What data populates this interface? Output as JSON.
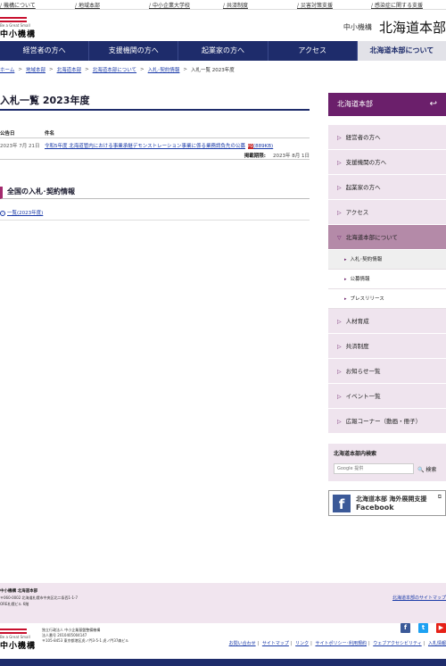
{
  "topbar": {
    "items": [
      "機構について",
      "地域本部",
      "中小企業大学校",
      "共済制度",
      "災害対策支援",
      "感染症に関する支援"
    ]
  },
  "header": {
    "logo_sub": "Be a Great Small",
    "logo_main": "中小機構",
    "org_name": "中小機構",
    "branch_name": "北海道本部"
  },
  "gnav": {
    "items": [
      "経営者の方へ",
      "支援機関の方へ",
      "起業家の方へ",
      "アクセス",
      "北海道本部について"
    ],
    "active_index": 4
  },
  "breadcrumb": {
    "items": [
      "ホーム",
      "地域本部",
      "北海道本部",
      "北海道本部について",
      "入札･契約情報"
    ],
    "current": "入札一覧 2023年度"
  },
  "main": {
    "title": "入札一覧 2023年度",
    "table": {
      "col_date": "公告日",
      "col_name": "件名",
      "rows": [
        {
          "date": "2023年 7月 21日",
          "title": "令和5年度 北海道管内における事業承継デモンストレーション事業に係る業務請負先の公募",
          "pdf_label": "PDF",
          "size": "(889KB)",
          "deadline_label": "掲載期限:",
          "deadline": "2023年 8月 1日"
        }
      ]
    },
    "national_section_title": "全国の入札･契約情報",
    "national_link": "一覧(2023年度)",
    "link_icon": "circle-arrow-icon"
  },
  "sidebar": {
    "header": "北海道本部",
    "back_icon": "return-arrow-icon",
    "items": [
      {
        "label": "経営者の方へ",
        "active": false
      },
      {
        "label": "支援機関の方へ",
        "active": false
      },
      {
        "label": "起業家の方へ",
        "active": false
      },
      {
        "label": "アクセス",
        "active": false
      },
      {
        "label": "北海道本部について",
        "active": true
      }
    ],
    "sub_items": [
      {
        "label": "入札･契約情報",
        "active": true
      },
      {
        "label": "公募情報",
        "active": false
      },
      {
        "label": "プレスリリース",
        "active": false
      }
    ],
    "items_after": [
      {
        "label": "人材育成"
      },
      {
        "label": "共済制度"
      },
      {
        "label": "お知らせ一覧"
      },
      {
        "label": "イベント一覧"
      },
      {
        "label": "広報コーナー（動画・冊子）"
      }
    ],
    "search": {
      "label": "北海道本部内検索",
      "placeholder": "Google 提供",
      "button": "検索"
    },
    "facebook": {
      "line1": "北海道本部 海外展開支援",
      "line2": "Facebook",
      "logo": "f"
    }
  },
  "footer": {
    "name": "中小機構 北海道本部",
    "address1": "〒060-0002 北海道札幌市中央区北二条西1-1-7",
    "address2": "ORE札幌ビル 6階",
    "sitemap_link": "北海道本部のサイトマップ",
    "logo_sub": "Be a Great Small",
    "logo_main": "中小機構",
    "org_line1": "独立行政法人 中小企業基盤整備機構",
    "org_line2": "法人番号 2010405004147",
    "org_line3": "〒105-8453 東京都港区虎ノ門3-5-1 虎ノ門37森ビル",
    "links": [
      "お問い合わせ",
      "サイトマップ",
      "リンク",
      "サイトポリシー･利用規約",
      "ウェブアクセシビリティ",
      "入札情報"
    ],
    "social_labels": [
      "f",
      "t",
      "▶"
    ],
    "colors": {
      "navy": "#1e2c6b",
      "purple": "#6b1f6b",
      "pink_bg": "#efe4ee",
      "accent_red": "#c8102e"
    }
  }
}
